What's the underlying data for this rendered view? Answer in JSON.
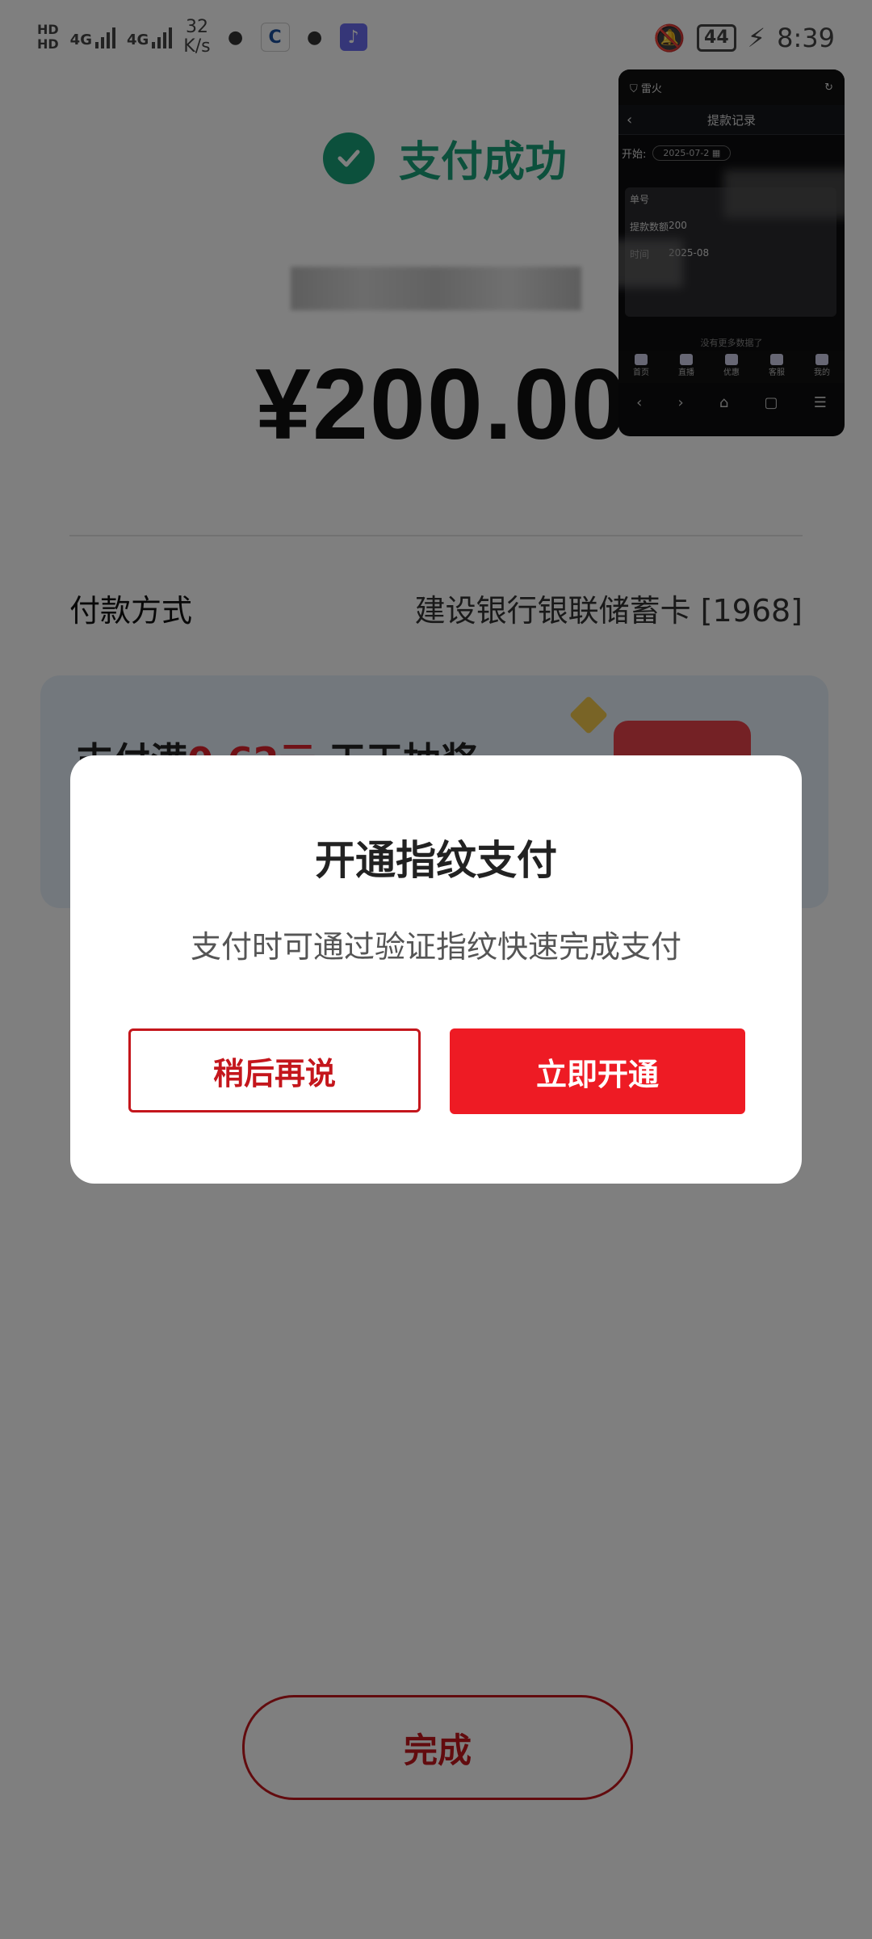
{
  "status_bar": {
    "hd1": "HD",
    "hd2": "HD",
    "net1": "4G",
    "net2": "4G",
    "speed_value": "32",
    "speed_unit": "K/s",
    "battery": "44",
    "time": "8:39"
  },
  "payment": {
    "success_text": "支付成功",
    "amount": "¥200.00",
    "method_label": "付款方式",
    "method_value": "建设银行银联储蓄卡 [1968]"
  },
  "promo": {
    "text_prefix": "支付满",
    "text_amount": "0.62元",
    "text_suffix": " 天天抽奖"
  },
  "done_button": "完成",
  "dialog": {
    "title": "开通指纹支付",
    "message": "支付时可通过验证指纹快速完成支付",
    "later_button": "稍后再说",
    "enable_button": "立即开通"
  },
  "floating_window": {
    "app_name": "雷火",
    "page_title": "提款记录",
    "filter_label": "开始:",
    "filter_date": "2025-07-2",
    "col_order": "单号",
    "row_label": "提款数额",
    "row_amount": "200",
    "row_time_label": "时间",
    "row_date": "2025-08",
    "empty_text": "没有更多数据了",
    "tabs": [
      "首页",
      "直播",
      "优惠",
      "客服",
      "我的"
    ]
  },
  "colors": {
    "success_green": "#19a079",
    "brand_red": "#ee1b24",
    "outline_red": "#c4161c"
  }
}
